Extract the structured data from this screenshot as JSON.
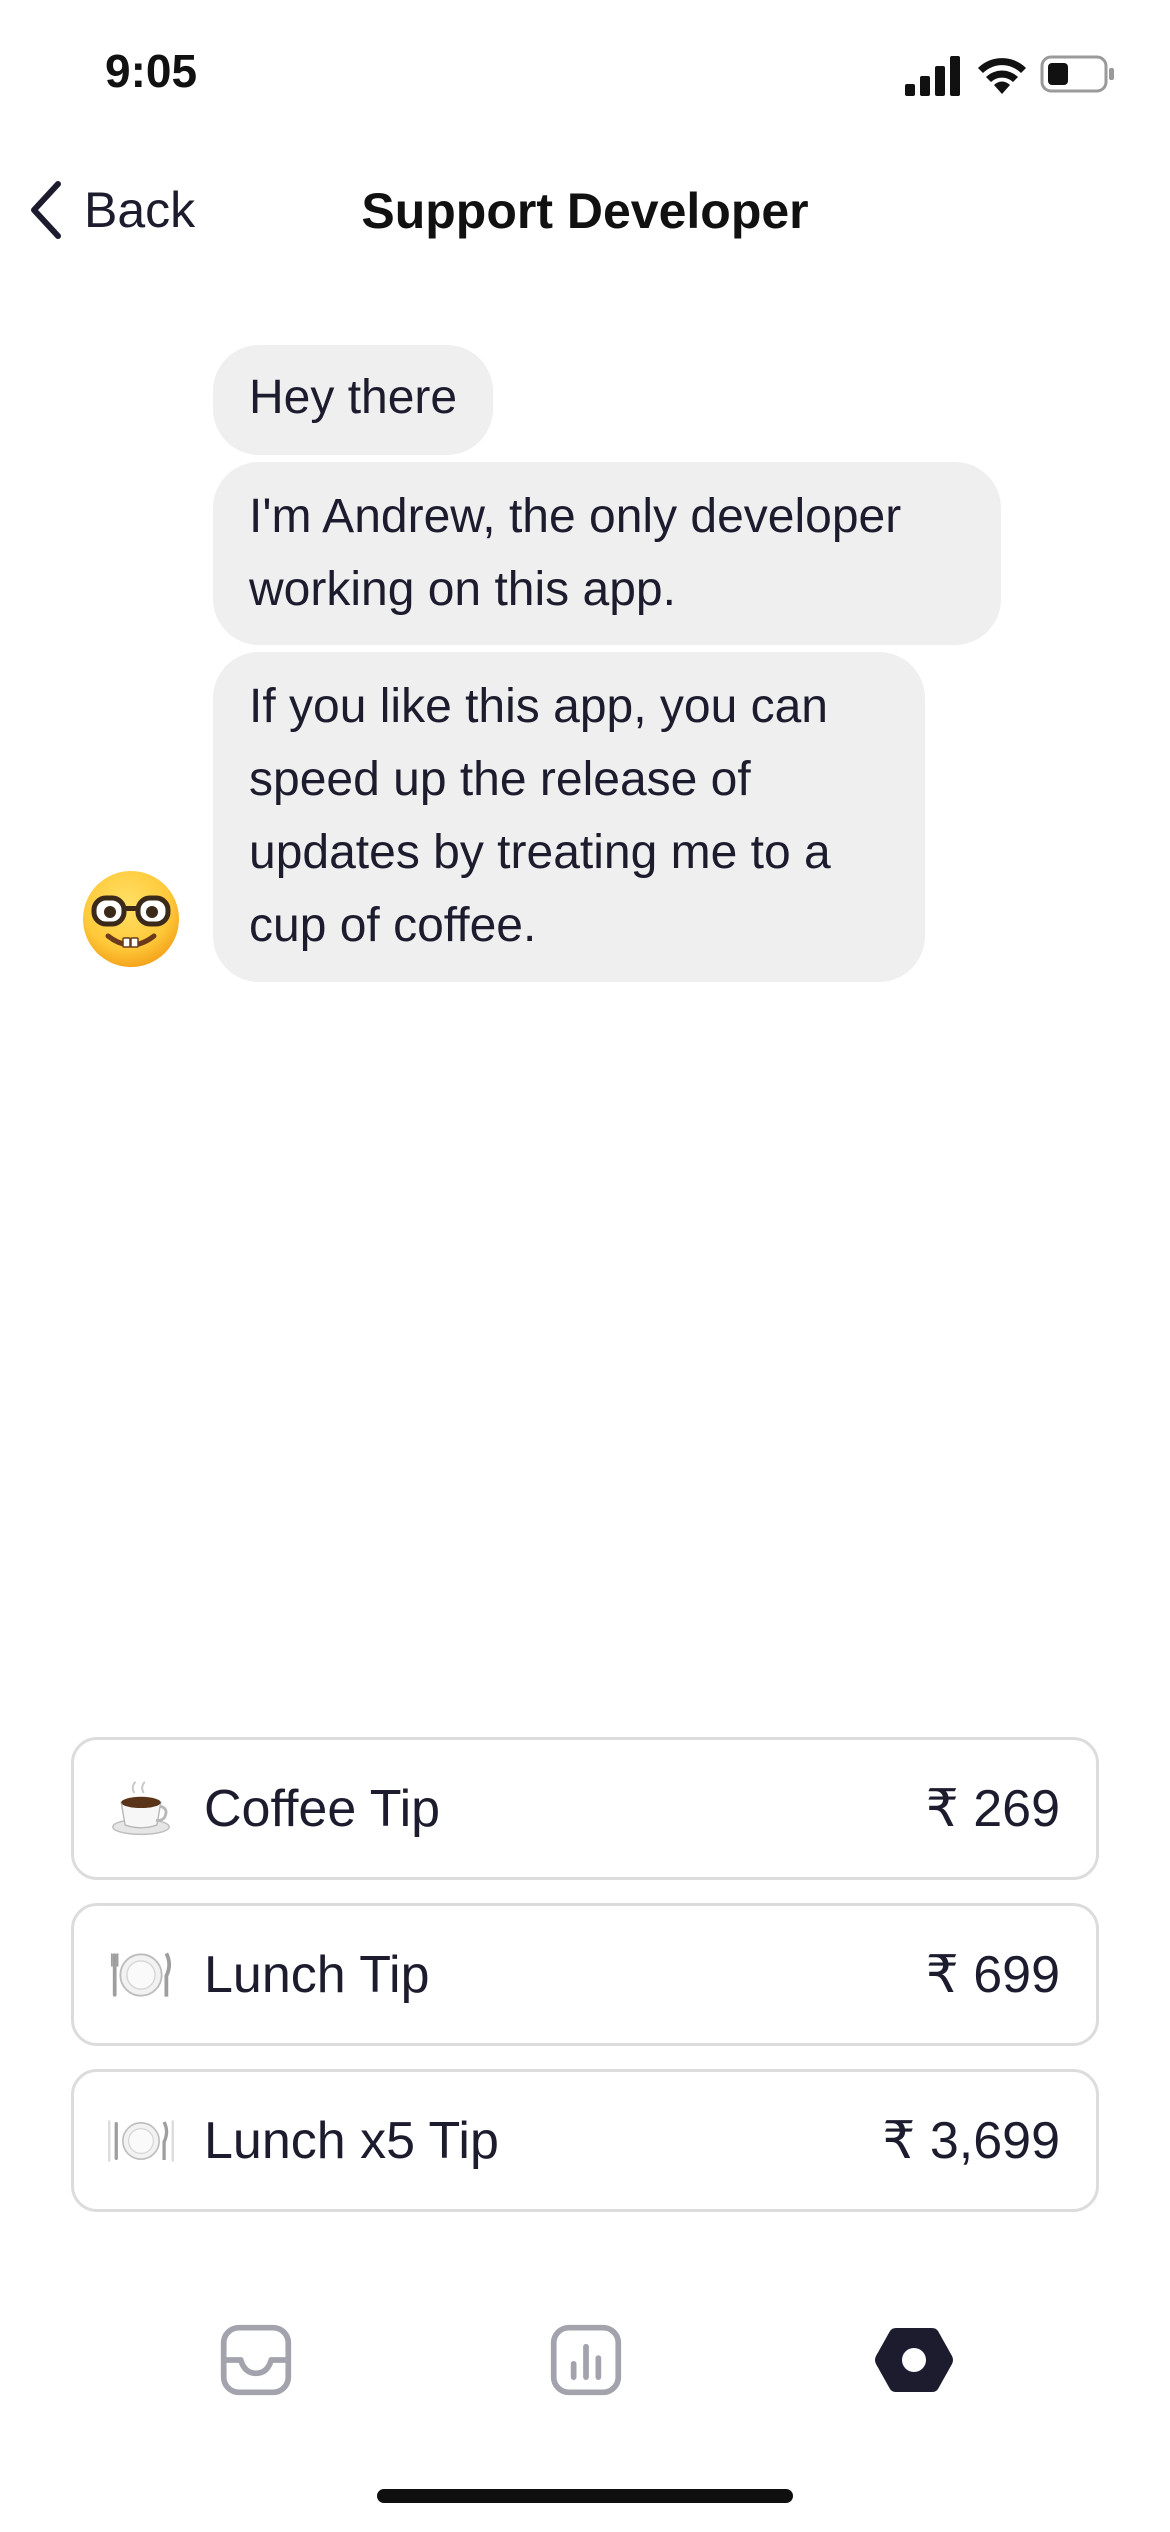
{
  "status_bar": {
    "time": "9:05",
    "icons": [
      "cellular-signal-icon",
      "wifi-icon",
      "battery-icon"
    ],
    "battery_level": 0.3
  },
  "nav": {
    "back_label": "Back",
    "title": "Support Developer"
  },
  "chat": {
    "avatar": "nerd-face-emoji",
    "messages": [
      "Hey there",
      "I'm Andrew, the only developer working on this app.",
      "If you like this app, you can speed up the release of updates by treating me to a cup of coffee."
    ]
  },
  "tips": [
    {
      "icon": "coffee-cup-icon",
      "label": "Coffee Tip",
      "price": "₹ 269"
    },
    {
      "icon": "plate-cutlery-icon",
      "label": "Lunch Tip",
      "price": "₹ 699"
    },
    {
      "icon": "plate-cutlery-stack-icon",
      "label": "Lunch x5 Tip",
      "price": "₹ 3,699"
    }
  ],
  "tab_bar": {
    "tabs": [
      {
        "icon": "inbox-tray-icon",
        "selected": false
      },
      {
        "icon": "bar-chart-icon",
        "selected": false
      },
      {
        "icon": "settings-hexagon-icon",
        "selected": true
      }
    ],
    "colors": {
      "selected": "#1c1c2e",
      "unselected": "#a3a3ad"
    }
  },
  "colors": {
    "bubble_background": "#efefef",
    "text": "#1c1c2e",
    "border": "#dcdcdc"
  }
}
